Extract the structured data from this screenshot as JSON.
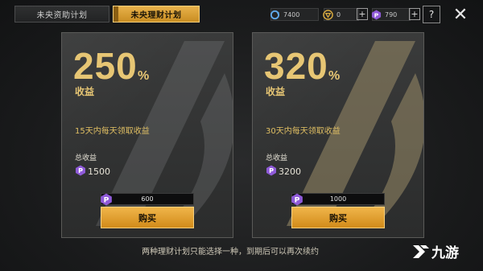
{
  "tabs": [
    {
      "label": "未央资助计划",
      "active": false
    },
    {
      "label": "未央理财计划",
      "active": true
    }
  ],
  "currencies": [
    {
      "icon": "refresh-currency-icon",
      "value": "7400"
    },
    {
      "icon": "triangle-coin-icon",
      "value": "0"
    },
    {
      "icon": "p-coin-icon",
      "value": "790"
    }
  ],
  "buttons": {
    "help": "?",
    "close": "✕",
    "plus": "+"
  },
  "plans": [
    {
      "percent": "250",
      "percent_sign": "%",
      "yield_label": "收益",
      "description": "15天内每天领取收益",
      "total_label": "总收益",
      "total_value": "1500",
      "price": "600",
      "buy_label": "购买"
    },
    {
      "percent": "320",
      "percent_sign": "%",
      "yield_label": "收益",
      "description": "30天内每天领取收益",
      "total_label": "总收益",
      "total_value": "3200",
      "price": "1000",
      "buy_label": "购买"
    }
  ],
  "footer_note": "两种理财计划只能选择一种，到期后可以再次续约",
  "watermark": "九游",
  "colors": {
    "accent_gold": "#e7c674",
    "button_orange": "#e0a033",
    "p_coin_purple": "#8f5ad8"
  }
}
